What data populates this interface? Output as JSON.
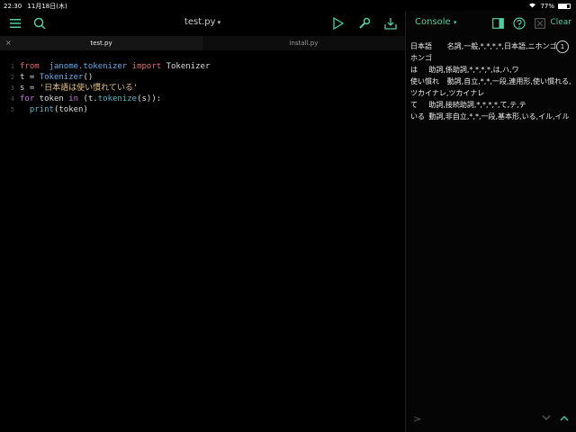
{
  "status_bar": {
    "time": "22:30",
    "date": "11月18日(木)",
    "battery": "77%",
    "battery_level": 0.77
  },
  "editor": {
    "title": "test.py",
    "tabs": [
      {
        "label": "test.py",
        "active": true
      },
      {
        "label": "install.py",
        "active": false
      }
    ],
    "line_numbers": [
      "1",
      "2",
      "3",
      "4",
      "5"
    ],
    "code": {
      "l1": {
        "from": "from",
        "module": "janome.tokenizer",
        "import": "import",
        "name": "Tokenizer"
      },
      "l2": {
        "lhs": "t = ",
        "call": "Tokenizer",
        "paren": "()"
      },
      "l3": {
        "lhs": "s = ",
        "str": "'日本語は使い慣れている'"
      },
      "l4": {
        "for": "for",
        "var": " token ",
        "in": "in",
        "pre": " (t.",
        "method": "tokenize",
        "post": "(s)):"
      },
      "l5": {
        "indent": "  ",
        "call": "print",
        "args": "(token)"
      }
    }
  },
  "console": {
    "title": "Console",
    "clear_label": "Clear",
    "badge": "1",
    "output": "日本語\t名詞,一般,*,*,*,*,日本語,ニホンゴ,ニホンゴ\nは\t助詞,係助詞,*,*,*,*,は,ハ,ワ\n使い慣れ\t動詞,自立,*,*,一段,連用形,使い慣れる,ツカイナレ,ツカイナレ\nて\t助詞,接続助詞,*,*,*,*,て,テ,テ\nいる\t動詞,非自立,*,*,一段,基本形,いる,イル,イル",
    "prompt": ">"
  },
  "colors": {
    "accent": "#4dd0a0",
    "keyword": "#e06c75",
    "string": "#e5c07b"
  },
  "icons": {
    "menu": "menu-icon",
    "search": "search-icon",
    "run": "play-icon",
    "wrench": "wrench-icon",
    "share": "share-icon",
    "panel": "panel-icon",
    "help": "help-icon",
    "close": "close-icon"
  }
}
